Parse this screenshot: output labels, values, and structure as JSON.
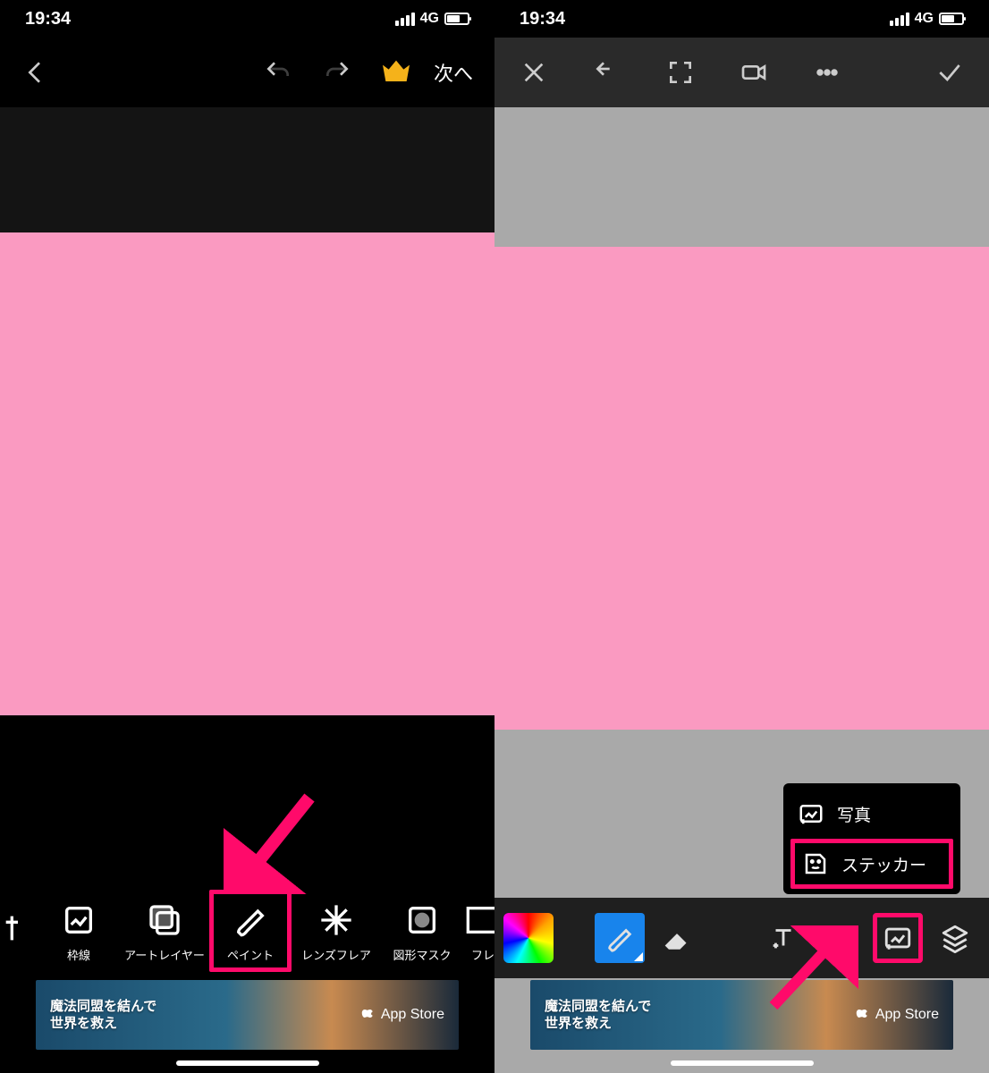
{
  "status": {
    "time": "19:34",
    "net": "4G"
  },
  "left": {
    "next_label": "次へ",
    "tools": [
      {
        "id": "edge",
        "label": ""
      },
      {
        "id": "frame",
        "label": "枠線"
      },
      {
        "id": "artlayer",
        "label": "アートレイヤー"
      },
      {
        "id": "paint",
        "label": "ペイント"
      },
      {
        "id": "lensflare",
        "label": "レンズフレア"
      },
      {
        "id": "shapemask",
        "label": "図形マスク"
      },
      {
        "id": "fre",
        "label": "フレ"
      }
    ],
    "highlight_index": 3,
    "ad": {
      "line1": "魔法同盟を結んで",
      "line2": "世界を救え",
      "store": "App Store"
    }
  },
  "right": {
    "popup": {
      "photo": "写真",
      "sticker": "ステッカー"
    },
    "ad": {
      "line1": "魔法同盟を結んで",
      "line2": "世界を救え",
      "store": "App Store"
    }
  },
  "colors": {
    "pink": "#fa9ac1",
    "highlight": "#ff0a6a",
    "brush_bg": "#1884ec"
  }
}
